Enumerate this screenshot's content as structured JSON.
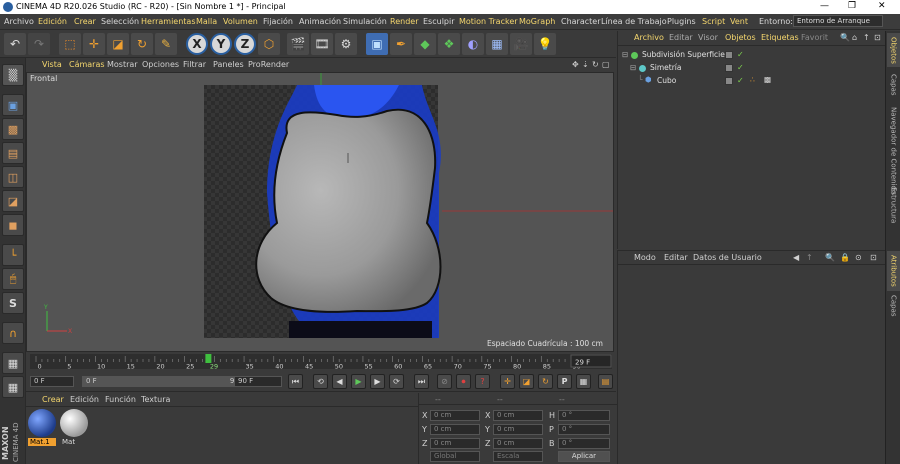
{
  "window": {
    "title": "CINEMA 4D R20.026 Studio (RC - R20) - [Sin Nombre 1 *] - Principal",
    "controls": [
      "—",
      "❐",
      "✕"
    ]
  },
  "menu": {
    "items": [
      "Archivo",
      "Edición",
      "Crear",
      "Selección",
      "Herramientas",
      "Malla",
      "Volumen",
      "Fijación",
      "Animación",
      "Simulación",
      "Render",
      "Esculpir",
      "Motion Tracker",
      "MoGraph",
      "Character",
      "Línea de Trabajo",
      "Plugins",
      "Script",
      "Vent"
    ],
    "env_label": "Entorno:",
    "env_value": "Entorno de Arranque"
  },
  "toolbar": {
    "icons": [
      "undo-icon",
      "redo-icon",
      "live-select-icon",
      "move-icon",
      "scale-icon",
      "rotate-icon",
      "recent-tool-icon",
      "x-axis-icon",
      "y-axis-icon",
      "z-axis-icon",
      "coordinate-system-icon",
      "render-view-icon",
      "render-picture-viewer-icon",
      "render-settings-icon",
      "cube-icon",
      "pen-icon",
      "subdivision-icon",
      "array-icon",
      "deformer-icon",
      "floor-icon",
      "camera-icon",
      "light-icon"
    ],
    "axis_labels": [
      "X",
      "Y",
      "Z"
    ]
  },
  "viewport": {
    "menu": [
      "Vista",
      "Cámaras",
      "Mostrar",
      "Opciones",
      "Filtrar",
      "Paneles",
      "ProRender"
    ],
    "label": "Frontal",
    "grid_spacing": "Espaciado Cuadrícula : 100 cm"
  },
  "timeline": {
    "ticks": [
      "0",
      "5",
      "10",
      "15",
      "20",
      "25",
      "29",
      "35",
      "40",
      "45",
      "50",
      "55",
      "60",
      "65",
      "70",
      "75",
      "80",
      "85",
      "90"
    ],
    "current_frame": 29,
    "current_frame_label": "29",
    "end_field": "29 F"
  },
  "transport": {
    "start": "0 F",
    "range_start": "0 F",
    "range_end": "90 F",
    "end": "90 F"
  },
  "materials": {
    "menu": [
      "Crear",
      "Edición",
      "Función",
      "Textura"
    ],
    "items": [
      {
        "name": "Mat.1",
        "color": "#2a4f9a",
        "selected": true
      },
      {
        "name": "Mat",
        "color": "#cfcfcf",
        "selected": false
      }
    ]
  },
  "coordinates": {
    "rows": [
      {
        "axis": "X",
        "pos": "0 cm",
        "size_axis": "X",
        "size": "0 cm",
        "rot_axis": "H",
        "rot": "0 °"
      },
      {
        "axis": "Y",
        "pos": "0 cm",
        "size_axis": "Y",
        "size": "0 cm",
        "rot_axis": "P",
        "rot": "0 °"
      },
      {
        "axis": "Z",
        "pos": "0 cm",
        "size_axis": "Z",
        "size": "0 cm",
        "rot_axis": "B",
        "rot": "0 °"
      }
    ],
    "mode1": "Global",
    "mode2": "Escala",
    "apply": "Aplicar",
    "headers": [
      "--",
      "--",
      "--"
    ]
  },
  "object_manager": {
    "menu": [
      "Archivo",
      "Editar",
      "Visor",
      "Objetos",
      "Etiquetas",
      "Favorit"
    ],
    "objects": [
      {
        "name": "Subdivisión Superficie",
        "indent": 0,
        "color": "#5ec85a"
      },
      {
        "name": "Simetría",
        "indent": 1,
        "color": "#5ec8c8"
      },
      {
        "name": "Cubo",
        "indent": 2,
        "color": "#5ea0e0"
      }
    ]
  },
  "attribute_manager": {
    "menu": [
      "Modo",
      "Editar",
      "Datos de Usuario"
    ]
  },
  "right_tabs": [
    "Objetos",
    "Capas",
    "Navegador de Contenido",
    "Estructura",
    "Atributos",
    "Capas"
  ],
  "branding": {
    "maxon": "MAXON",
    "c4d": "CINEMA 4D"
  },
  "colors": {
    "accent": "#f5d76e",
    "selection": "#3f6db3",
    "panel": "#3a3a3a"
  }
}
